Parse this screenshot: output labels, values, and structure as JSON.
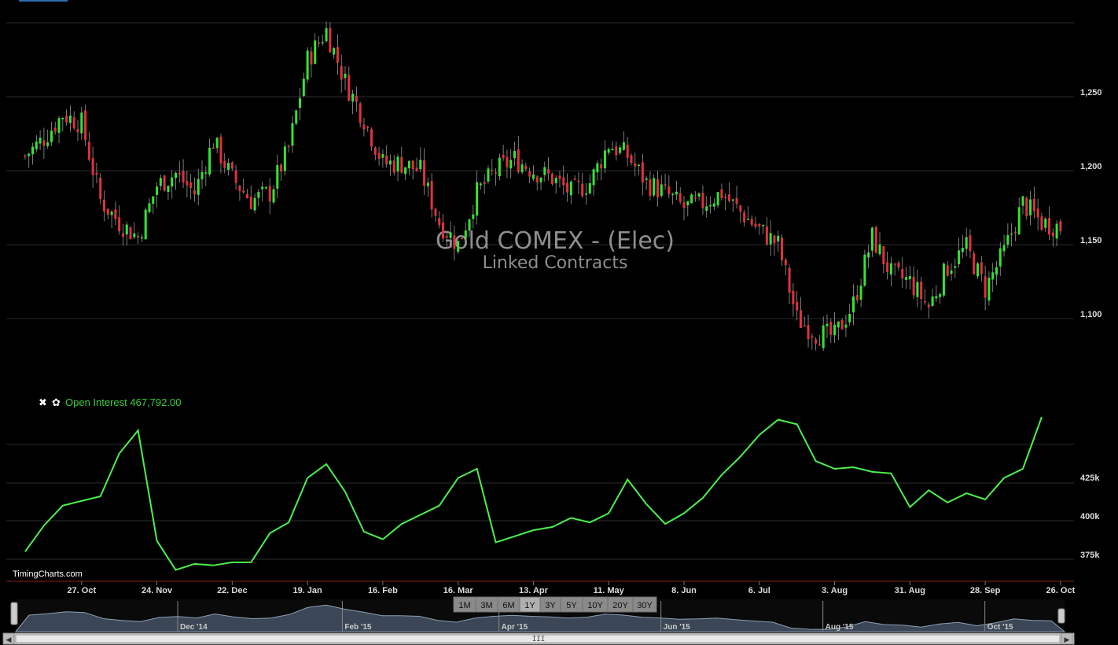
{
  "watermark": {
    "title": "Gold COMEX - (Elec)",
    "subtitle": "Linked Contracts"
  },
  "brand": "TimingCharts.com",
  "indicator": {
    "label": "Open Interest 467,792.00",
    "close_icon": "close-icon",
    "settings_icon": "gear-icon"
  },
  "range_buttons": [
    "1M",
    "3M",
    "6M",
    "1Y",
    "3Y",
    "5Y",
    "10Y",
    "20Y",
    "30Y"
  ],
  "active_range": "1Y",
  "scrollbar_grip": "III",
  "navigator_labels": [
    "Dec '14",
    "Feb '15",
    "Apr '15",
    "Jun '15",
    "Aug '15",
    "Oct '15"
  ],
  "colors": {
    "up": "#33e433",
    "down": "#e0323c",
    "oi_line": "#4cf04c",
    "oi_label": "#3ccf3c",
    "grid": "#2b2b2b",
    "navigator_fill": "#3b4656"
  },
  "chart_data": [
    {
      "type": "candlestick",
      "title": "Gold COMEX - (Elec)",
      "subtitle": "Linked Contracts",
      "y_axis_ticks": [
        "1,100",
        "1,150",
        "1,200",
        "1,250"
      ],
      "ylim": [
        1070,
        1310
      ],
      "x_axis_ticks": [
        "27. Oct",
        "24. Nov",
        "22. Dec",
        "19. Jan",
        "16. Feb",
        "16. Mar",
        "13. Apr",
        "11. May",
        "8. Jun",
        "6. Jul",
        "3. Aug",
        "31. Aug",
        "28. Sep",
        "26. Oct"
      ],
      "grid": true,
      "weekly_close_path": [
        {
          "x": "2014-10-06",
          "y": 1210
        },
        {
          "x": "2014-10-13",
          "y": 1222
        },
        {
          "x": "2014-10-20",
          "y": 1238
        },
        {
          "x": "2014-10-27",
          "y": 1232
        },
        {
          "x": "2014-11-03",
          "y": 1180
        },
        {
          "x": "2014-11-10",
          "y": 1165
        },
        {
          "x": "2014-11-17",
          "y": 1155
        },
        {
          "x": "2014-11-24",
          "y": 1190
        },
        {
          "x": "2014-12-01",
          "y": 1198
        },
        {
          "x": "2014-12-08",
          "y": 1185
        },
        {
          "x": "2014-12-15",
          "y": 1220
        },
        {
          "x": "2014-12-22",
          "y": 1195
        },
        {
          "x": "2014-12-29",
          "y": 1180
        },
        {
          "x": "2015-01-05",
          "y": 1185
        },
        {
          "x": "2015-01-12",
          "y": 1215
        },
        {
          "x": "2015-01-19",
          "y": 1275
        },
        {
          "x": "2015-01-26",
          "y": 1295
        },
        {
          "x": "2015-02-02",
          "y": 1260
        },
        {
          "x": "2015-02-09",
          "y": 1235
        },
        {
          "x": "2015-02-16",
          "y": 1205
        },
        {
          "x": "2015-02-23",
          "y": 1205
        },
        {
          "x": "2015-03-02",
          "y": 1200
        },
        {
          "x": "2015-03-09",
          "y": 1165
        },
        {
          "x": "2015-03-16",
          "y": 1150
        },
        {
          "x": "2015-03-23",
          "y": 1185
        },
        {
          "x": "2015-03-30",
          "y": 1200
        },
        {
          "x": "2015-04-06",
          "y": 1208
        },
        {
          "x": "2015-04-13",
          "y": 1200
        },
        {
          "x": "2015-04-20",
          "y": 1195
        },
        {
          "x": "2015-04-27",
          "y": 1185
        },
        {
          "x": "2015-05-04",
          "y": 1192
        },
        {
          "x": "2015-05-11",
          "y": 1218
        },
        {
          "x": "2015-05-18",
          "y": 1210
        },
        {
          "x": "2015-05-25",
          "y": 1192
        },
        {
          "x": "2015-06-01",
          "y": 1185
        },
        {
          "x": "2015-06-08",
          "y": 1175
        },
        {
          "x": "2015-06-15",
          "y": 1178
        },
        {
          "x": "2015-06-22",
          "y": 1185
        },
        {
          "x": "2015-06-29",
          "y": 1172
        },
        {
          "x": "2015-07-06",
          "y": 1160
        },
        {
          "x": "2015-07-13",
          "y": 1150
        },
        {
          "x": "2015-07-20",
          "y": 1100
        },
        {
          "x": "2015-07-27",
          "y": 1090
        },
        {
          "x": "2015-08-03",
          "y": 1088
        },
        {
          "x": "2015-08-10",
          "y": 1110
        },
        {
          "x": "2015-08-17",
          "y": 1155
        },
        {
          "x": "2015-08-24",
          "y": 1130
        },
        {
          "x": "2015-08-31",
          "y": 1125
        },
        {
          "x": "2015-09-07",
          "y": 1108
        },
        {
          "x": "2015-09-14",
          "y": 1135
        },
        {
          "x": "2015-09-21",
          "y": 1148
        },
        {
          "x": "2015-09-28",
          "y": 1120
        },
        {
          "x": "2015-10-05",
          "y": 1145
        },
        {
          "x": "2015-10-12",
          "y": 1178
        },
        {
          "x": "2015-10-19",
          "y": 1165
        },
        {
          "x": "2015-10-26",
          "y": 1162
        }
      ]
    },
    {
      "type": "line",
      "name": "Open Interest",
      "last_value": 467792,
      "y_axis_ticks": [
        "375k",
        "400k",
        "425k"
      ],
      "ylim": [
        366000,
        474000
      ],
      "points": [
        {
          "x": "2014-10-06",
          "y": 380000
        },
        {
          "x": "2014-10-13",
          "y": 397000
        },
        {
          "x": "2014-10-20",
          "y": 410000
        },
        {
          "x": "2014-10-27",
          "y": 413000
        },
        {
          "x": "2014-11-03",
          "y": 416000
        },
        {
          "x": "2014-11-10",
          "y": 444000
        },
        {
          "x": "2014-11-17",
          "y": 459000
        },
        {
          "x": "2014-11-24",
          "y": 387000
        },
        {
          "x": "2014-12-01",
          "y": 368000
        },
        {
          "x": "2014-12-08",
          "y": 372000
        },
        {
          "x": "2014-12-15",
          "y": 371000
        },
        {
          "x": "2014-12-22",
          "y": 373000
        },
        {
          "x": "2014-12-29",
          "y": 373000
        },
        {
          "x": "2015-01-05",
          "y": 392000
        },
        {
          "x": "2015-01-12",
          "y": 399000
        },
        {
          "x": "2015-01-19",
          "y": 428000
        },
        {
          "x": "2015-01-26",
          "y": 437000
        },
        {
          "x": "2015-02-02",
          "y": 419000
        },
        {
          "x": "2015-02-09",
          "y": 393000
        },
        {
          "x": "2015-02-16",
          "y": 388000
        },
        {
          "x": "2015-02-23",
          "y": 398000
        },
        {
          "x": "2015-03-02",
          "y": 404000
        },
        {
          "x": "2015-03-09",
          "y": 410000
        },
        {
          "x": "2015-03-16",
          "y": 428000
        },
        {
          "x": "2015-03-23",
          "y": 434000
        },
        {
          "x": "2015-03-30",
          "y": 386000
        },
        {
          "x": "2015-04-06",
          "y": 390000
        },
        {
          "x": "2015-04-13",
          "y": 394000
        },
        {
          "x": "2015-04-20",
          "y": 396000
        },
        {
          "x": "2015-04-27",
          "y": 402000
        },
        {
          "x": "2015-05-04",
          "y": 399000
        },
        {
          "x": "2015-05-11",
          "y": 405000
        },
        {
          "x": "2015-05-18",
          "y": 427000
        },
        {
          "x": "2015-05-25",
          "y": 411000
        },
        {
          "x": "2015-06-01",
          "y": 398000
        },
        {
          "x": "2015-06-08",
          "y": 405000
        },
        {
          "x": "2015-06-15",
          "y": 415000
        },
        {
          "x": "2015-06-22",
          "y": 430000
        },
        {
          "x": "2015-06-29",
          "y": 442000
        },
        {
          "x": "2015-07-06",
          "y": 456000
        },
        {
          "x": "2015-07-13",
          "y": 466000
        },
        {
          "x": "2015-07-20",
          "y": 463000
        },
        {
          "x": "2015-07-27",
          "y": 439000
        },
        {
          "x": "2015-08-03",
          "y": 434000
        },
        {
          "x": "2015-08-10",
          "y": 435000
        },
        {
          "x": "2015-08-17",
          "y": 432000
        },
        {
          "x": "2015-08-24",
          "y": 431000
        },
        {
          "x": "2015-08-31",
          "y": 409000
        },
        {
          "x": "2015-09-07",
          "y": 420000
        },
        {
          "x": "2015-09-14",
          "y": 412000
        },
        {
          "x": "2015-09-21",
          "y": 418000
        },
        {
          "x": "2015-09-28",
          "y": 414000
        },
        {
          "x": "2015-10-05",
          "y": 428000
        },
        {
          "x": "2015-10-12",
          "y": 434000
        },
        {
          "x": "2015-10-19",
          "y": 467792
        }
      ]
    }
  ]
}
